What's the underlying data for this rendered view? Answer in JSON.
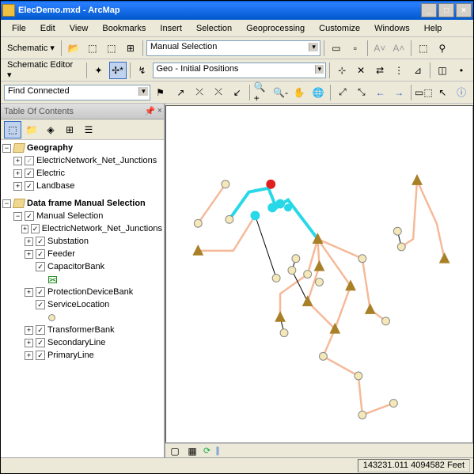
{
  "window": {
    "title": "ElecDemo.mxd - ArcMap"
  },
  "menu": [
    "File",
    "Edit",
    "View",
    "Bookmarks",
    "Insert",
    "Selection",
    "Geoprocessing",
    "Customize",
    "Windows",
    "Help"
  ],
  "toolbar1": {
    "schematic": "Schematic",
    "layer_select": "Manual Selection"
  },
  "toolbar2": {
    "editor": "Schematic Editor",
    "algo_select": "Geo - Initial Positions"
  },
  "toolbar3": {
    "trace_select": "Find Connected"
  },
  "toc": {
    "title": "Table Of Contents",
    "groups": [
      {
        "label": "Geography",
        "bold": true,
        "expanded": true,
        "children": [
          {
            "label": "ElectricNetwork_Net_Junctions",
            "checked": true,
            "expandable": true,
            "greycheck": true
          },
          {
            "label": "Electric",
            "checked": true,
            "expandable": true
          },
          {
            "label": "Landbase",
            "checked": true,
            "expandable": true
          }
        ]
      },
      {
        "label": "Data frame Manual Selection",
        "bold": true,
        "expanded": true,
        "children": [
          {
            "label": "Manual Selection",
            "checked": true,
            "expanded": true,
            "children": [
              {
                "label": "ElectricNetwork_Net_Junctions",
                "checked": true,
                "expandable": true
              },
              {
                "label": "Substation",
                "checked": true,
                "expandable": true
              },
              {
                "label": "Feeder",
                "checked": true,
                "expandable": true
              },
              {
                "label": "CapacitorBank",
                "checked": true,
                "expanded": true,
                "symbol": "box"
              },
              {
                "label": "ProtectionDeviceBank",
                "checked": true,
                "expandable": true
              },
              {
                "label": "ServiceLocation",
                "checked": true,
                "expanded": true,
                "symbol": "circle"
              },
              {
                "label": "TransformerBank",
                "checked": true,
                "expandable": true
              },
              {
                "label": "SecondaryLine",
                "checked": true,
                "expandable": true
              },
              {
                "label": "PrimaryLine",
                "checked": true,
                "expandable": true
              }
            ]
          }
        ]
      }
    ]
  },
  "status": {
    "coords": "143231.011 4094582 Feet"
  },
  "colors": {
    "primary_line": "#f5b998",
    "feeder": "#28d8e8",
    "substation": "#e02020",
    "transformer": "#a88028"
  },
  "map_bottom_icons": [
    "layout-view",
    "data-view",
    "refresh",
    "pause"
  ]
}
